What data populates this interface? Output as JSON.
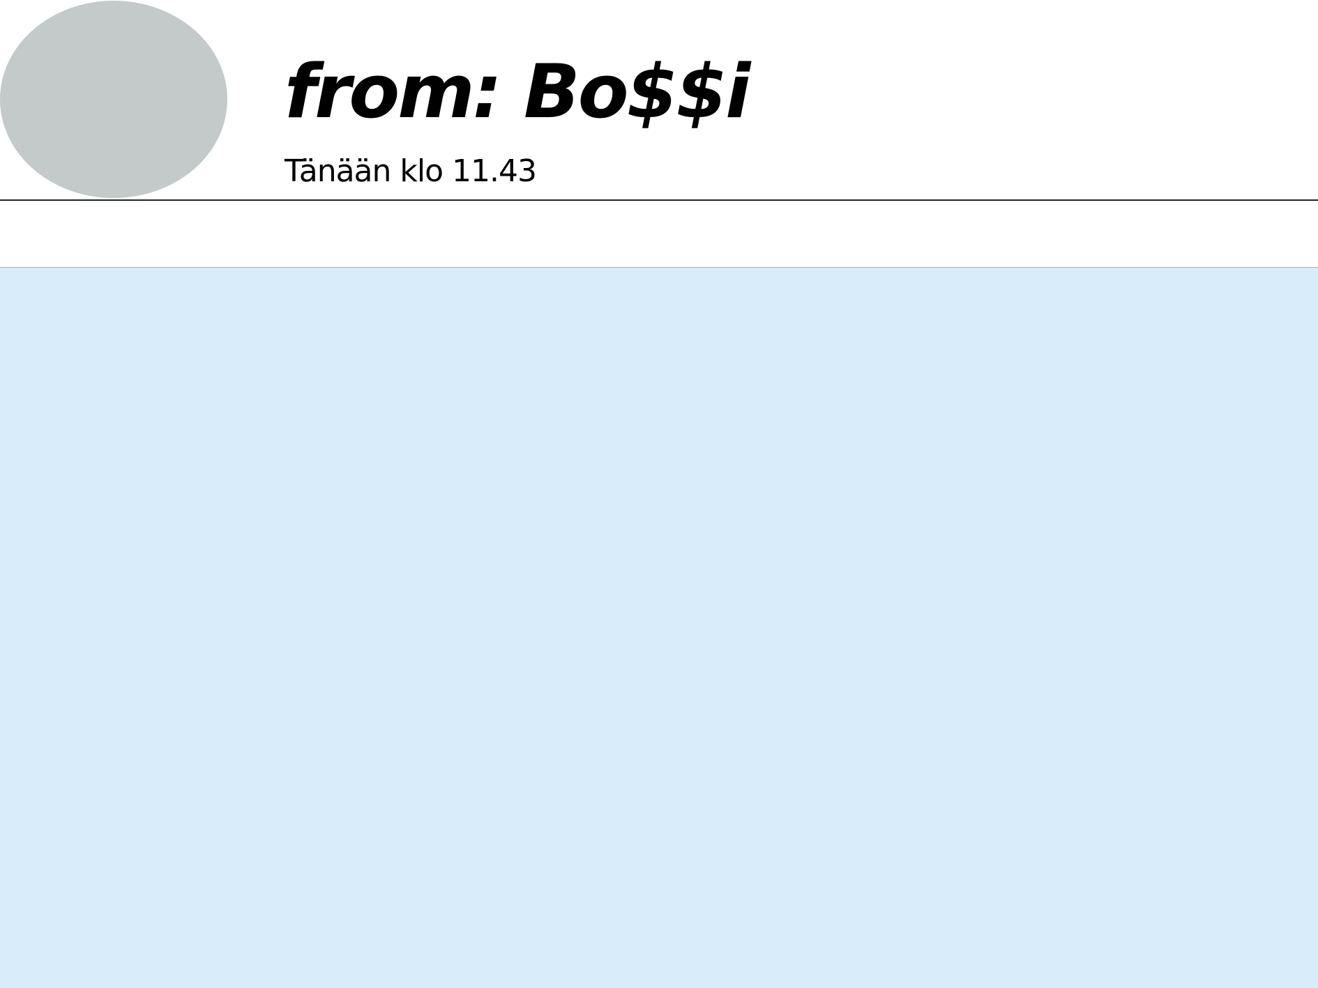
{
  "message": {
    "sender": "from: Bo$$i",
    "timestamp": "Tänään klo 11.43",
    "subject": "",
    "body": ""
  },
  "colors": {
    "avatar": "#c4c9c9",
    "header_background": "#ffffff",
    "divider": "#222222",
    "body_background": "#d8ecf9"
  },
  "icons": {
    "avatar": "avatar-placeholder"
  }
}
